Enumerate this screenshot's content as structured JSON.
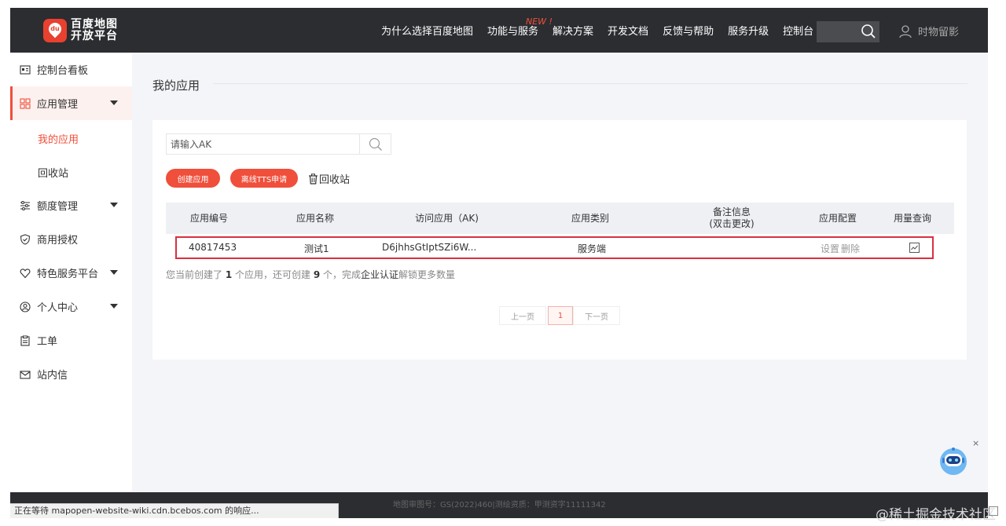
{
  "nav": {
    "logo_line1": "百度地图",
    "logo_line2": "开放平台",
    "logo_badge": "du",
    "items": [
      "为什么选择百度地图",
      "功能与服务",
      "解决方案",
      "开发文档",
      "反馈与帮助",
      "服务升级",
      "控制台"
    ],
    "new_badge": "NEW !",
    "user_name": "时物留影"
  },
  "sidebar": {
    "items": [
      {
        "label": "控制台看板",
        "icon": "dashboard-icon"
      },
      {
        "label": "应用管理",
        "icon": "grid-icon"
      },
      {
        "label": "额度管理",
        "icon": "sliders-icon"
      },
      {
        "label": "商用授权",
        "icon": "shield-icon"
      },
      {
        "label": "特色服务平台",
        "icon": "heart-icon"
      },
      {
        "label": "个人中心",
        "icon": "user-icon"
      },
      {
        "label": "工单",
        "icon": "clipboard-icon"
      },
      {
        "label": "站内信",
        "icon": "mail-icon"
      }
    ],
    "sub_items": [
      "我的应用",
      "回收站"
    ]
  },
  "main": {
    "title": "我的应用",
    "search_placeholder": "请输入AK",
    "create_button": "创建应用",
    "tts_button": "离线TTS申请",
    "recycle_link": "回收站",
    "table": {
      "headers": [
        "应用编号",
        "应用名称",
        "访问应用（AK)",
        "应用类别",
        "备注信息",
        "(双击更改)",
        "应用配置",
        "用量查询"
      ],
      "rows": [
        {
          "id": "40817453",
          "name": "测试1",
          "ak": "D6jhhsGtIptSZi6W...",
          "type": "服务端",
          "note": "",
          "op_settings": "设置",
          "op_delete": "删除"
        }
      ]
    },
    "hint": {
      "p1": "您当前创建了 ",
      "n1": "1",
      "p2": " 个应用，还可创建 ",
      "n2": "9",
      "p3": " 个，完成",
      "link": "企业认证",
      "p4": "解锁更多数量"
    },
    "pagination": {
      "prev": "上一页",
      "current": "1",
      "next": "下一页"
    }
  },
  "footer": {
    "text": "地图审图号：GS(2022)460|测绘资质：甲测资字11111342"
  },
  "status_bar": "正在等待 mapopen-website-wiki.cdn.bcebos.com 的响应...",
  "watermark": "@稀土掘金技术社区",
  "colors": {
    "accent": "#ef4f3b",
    "nav_bg": "#2b2d31",
    "highlight_border": "#d9303f"
  }
}
